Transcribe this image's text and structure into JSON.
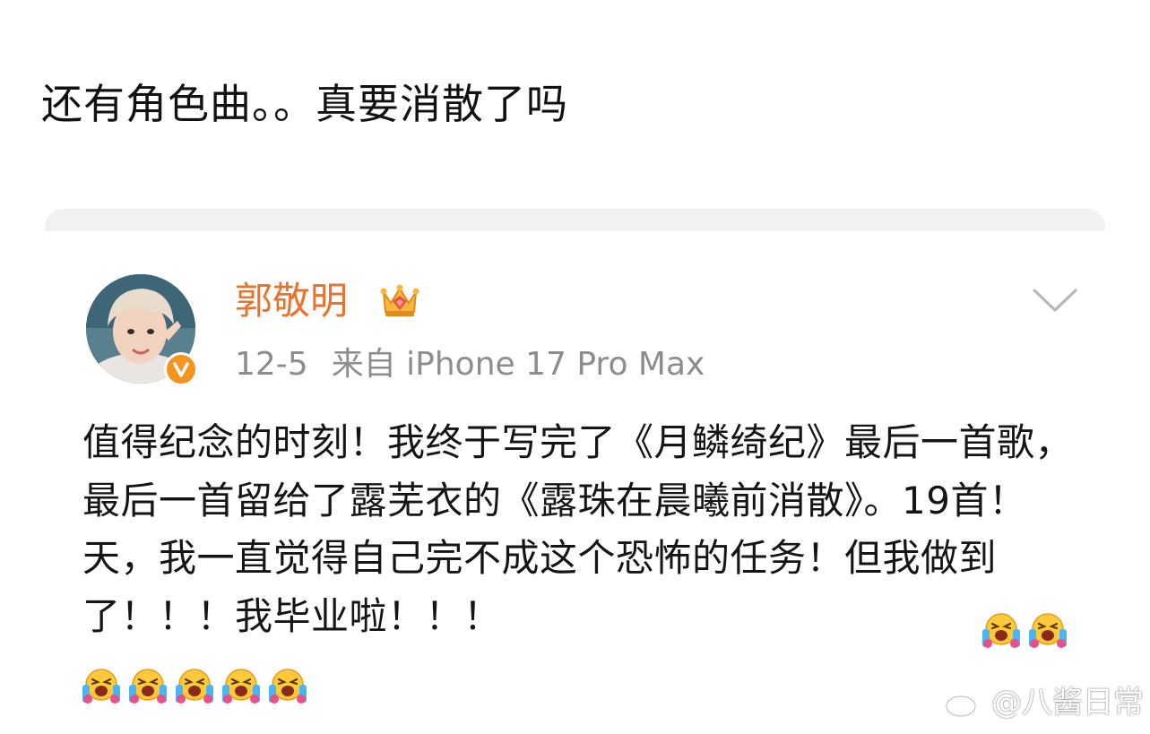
{
  "caption": "还有角色曲。。真要消散了吗",
  "post": {
    "username": "郭敬明",
    "date": "12-5",
    "source": "来自 iPhone 17 Pro Max",
    "body": "值得纪念的时刻！我终于写完了《月鳞绮纪》最后一首歌，最后一首留给了露芜衣的《露珠在晨曦前消散》。19首！天，我一直觉得自己完不成这个恐怖的任务！但我做到了！！！我毕业啦！！！",
    "verified_badge_color": "#f7941d",
    "username_color": "#e8732e",
    "icons": {
      "crown": "crown-badge-icon",
      "verified": "verified-v-icon",
      "expand": "chevron-down-icon",
      "emoji": "laugh-cry-emoji-icon"
    }
  },
  "watermark": {
    "text": "@八酱日常",
    "icon": "weibo-logo-icon"
  }
}
